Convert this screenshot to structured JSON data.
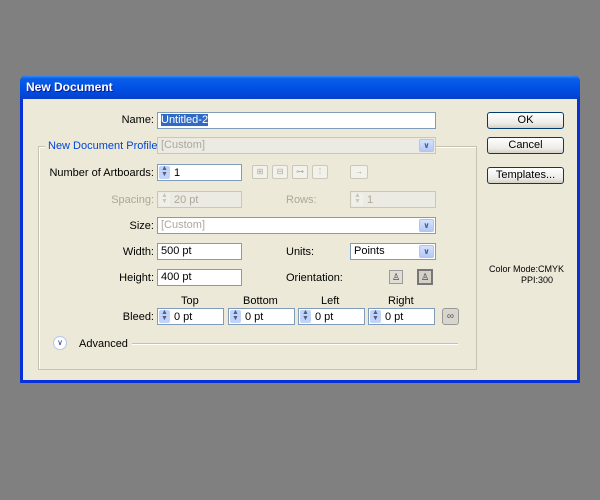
{
  "window": {
    "title": "New Document"
  },
  "form": {
    "name_label": "Name:",
    "name_value": "Untitled-2",
    "profile_label": "New Document Profile:",
    "profile_value": "[Custom]",
    "artboards_label": "Number of Artboards:",
    "artboards_value": "1",
    "spacing_label": "Spacing:",
    "spacing_value": "20 pt",
    "rows_label": "Rows:",
    "rows_value": "1",
    "size_label": "Size:",
    "size_value": "[Custom]",
    "width_label": "Width:",
    "width_value": "500 pt",
    "units_label": "Units:",
    "units_value": "Points",
    "height_label": "Height:",
    "height_value": "400 pt",
    "orientation_label": "Orientation:",
    "bleed_label": "Bleed:",
    "bleed": {
      "top_label": "Top",
      "top_value": "0 pt",
      "bottom_label": "Bottom",
      "bottom_value": "0 pt",
      "left_label": "Left",
      "left_value": "0 pt",
      "right_label": "Right",
      "right_value": "0 pt"
    },
    "advanced_label": "Advanced"
  },
  "buttons": {
    "ok": "OK",
    "cancel": "Cancel",
    "templates": "Templates..."
  },
  "info": {
    "color_mode": "Color Mode:CMYK",
    "ppi": "PPI:300"
  },
  "icons": {
    "chevron_down": "⌄",
    "spin": "▲▼",
    "arrow_right": "→",
    "advanced": "»",
    "link": "∞"
  }
}
